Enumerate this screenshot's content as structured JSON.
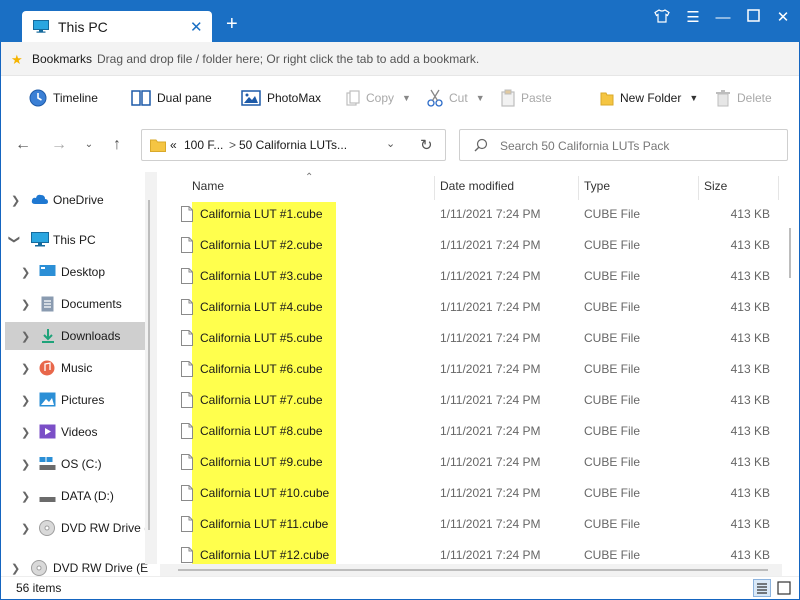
{
  "window": {
    "tab_title": "This PC",
    "tab_icon": "computer-icon",
    "accent_color": "#1a6fc4"
  },
  "bookmarks": {
    "label": "Bookmarks",
    "hint": "Drag and drop file / folder here; Or right click the tab to add a bookmark."
  },
  "toolbar": {
    "timeline": "Timeline",
    "dual_pane": "Dual pane",
    "photomax": "PhotoMax",
    "copy": "Copy",
    "cut": "Cut",
    "paste": "Paste",
    "new_folder": "New Folder",
    "delete": "Delete"
  },
  "address": {
    "overflow": "«",
    "segment_1": "100 F...",
    "separator": ">",
    "segment_2": "50 California LUTs..."
  },
  "search": {
    "placeholder": "Search 50 California LUTs Pack"
  },
  "sidebar": {
    "items": [
      {
        "label": "OneDrive",
        "icon": "cloud-icon"
      },
      {
        "label": "This PC",
        "icon": "computer-icon"
      },
      {
        "label": "Desktop",
        "icon": "desktop-icon"
      },
      {
        "label": "Documents",
        "icon": "documents-icon"
      },
      {
        "label": "Downloads",
        "icon": "download-icon"
      },
      {
        "label": "Music",
        "icon": "music-icon"
      },
      {
        "label": "Pictures",
        "icon": "pictures-icon"
      },
      {
        "label": "Videos",
        "icon": "videos-icon"
      },
      {
        "label": "OS (C:)",
        "icon": "drive-icon"
      },
      {
        "label": "DATA (D:)",
        "icon": "drive-icon"
      },
      {
        "label": "DVD RW Drive (",
        "icon": "disc-icon"
      },
      {
        "label": "DVD RW Drive (E",
        "icon": "disc-icon"
      }
    ]
  },
  "columns": {
    "name": "Name",
    "date": "Date modified",
    "type": "Type",
    "size": "Size"
  },
  "files": [
    {
      "name": "California LUT #1.cube",
      "date": "1/11/2021 7:24 PM",
      "type": "CUBE File",
      "size": "413 KB"
    },
    {
      "name": "California LUT #2.cube",
      "date": "1/11/2021 7:24 PM",
      "type": "CUBE File",
      "size": "413 KB"
    },
    {
      "name": "California LUT #3.cube",
      "date": "1/11/2021 7:24 PM",
      "type": "CUBE File",
      "size": "413 KB"
    },
    {
      "name": "California LUT #4.cube",
      "date": "1/11/2021 7:24 PM",
      "type": "CUBE File",
      "size": "413 KB"
    },
    {
      "name": "California LUT #5.cube",
      "date": "1/11/2021 7:24 PM",
      "type": "CUBE File",
      "size": "413 KB"
    },
    {
      "name": "California LUT #6.cube",
      "date": "1/11/2021 7:24 PM",
      "type": "CUBE File",
      "size": "413 KB"
    },
    {
      "name": "California LUT #7.cube",
      "date": "1/11/2021 7:24 PM",
      "type": "CUBE File",
      "size": "413 KB"
    },
    {
      "name": "California LUT #8.cube",
      "date": "1/11/2021 7:24 PM",
      "type": "CUBE File",
      "size": "413 KB"
    },
    {
      "name": "California LUT #9.cube",
      "date": "1/11/2021 7:24 PM",
      "type": "CUBE File",
      "size": "413 KB"
    },
    {
      "name": "California LUT #10.cube",
      "date": "1/11/2021 7:24 PM",
      "type": "CUBE File",
      "size": "413 KB"
    },
    {
      "name": "California LUT #11.cube",
      "date": "1/11/2021 7:24 PM",
      "type": "CUBE File",
      "size": "413 KB"
    },
    {
      "name": "California LUT #12.cube",
      "date": "1/11/2021 7:24 PM",
      "type": "CUBE File",
      "size": "413 KB"
    }
  ],
  "status": {
    "count": "56 items"
  },
  "highlight_color": "#ffff4d"
}
